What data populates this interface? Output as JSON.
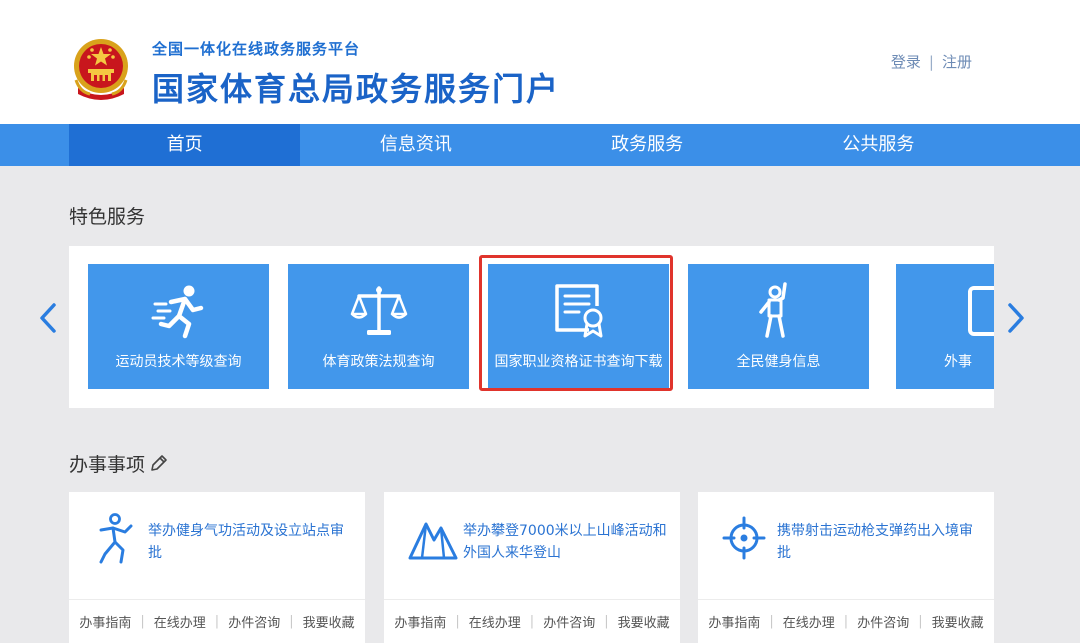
{
  "header": {
    "platform_name": "全国一体化在线政务服务平台",
    "portal_title": "国家体育总局政务服务门户",
    "login": "登录",
    "separator": "|",
    "register": "注册"
  },
  "nav": {
    "items": [
      {
        "label": "首页",
        "active": true
      },
      {
        "label": "信息资讯"
      },
      {
        "label": "政务服务"
      },
      {
        "label": "公共服务"
      }
    ]
  },
  "featured": {
    "title": "特色服务",
    "cards": [
      {
        "label": "运动员技术等级查询",
        "icon": "running-person-icon"
      },
      {
        "label": "体育政策法规查询",
        "icon": "scales-icon"
      },
      {
        "label": "国家职业资格证书查询下载",
        "icon": "certificate-icon",
        "highlighted": true
      },
      {
        "label": "全民健身信息",
        "icon": "fitness-person-icon"
      },
      {
        "label": "外事",
        "icon": "document-icon"
      }
    ]
  },
  "affairs": {
    "title": "办事事项",
    "cards": [
      {
        "title": "举办健身气功活动及设立站点审批",
        "icon": "qigong-person-icon"
      },
      {
        "title": "举办攀登7000米以上山峰活动和外国人来华登山",
        "icon": "mountain-icon"
      },
      {
        "title": "携带射击运动枪支弹药出入境审批",
        "icon": "crosshair-icon"
      }
    ],
    "actions": [
      "办事指南",
      "在线办理",
      "办件咨询",
      "我要收藏"
    ],
    "action_separator": "|"
  },
  "colors": {
    "brand_blue": "#3b8fe8",
    "nav_active": "#1f6fd4",
    "card_blue": "#4297eb",
    "highlight_red": "#e0342c",
    "title_blue": "#1a63c7"
  }
}
